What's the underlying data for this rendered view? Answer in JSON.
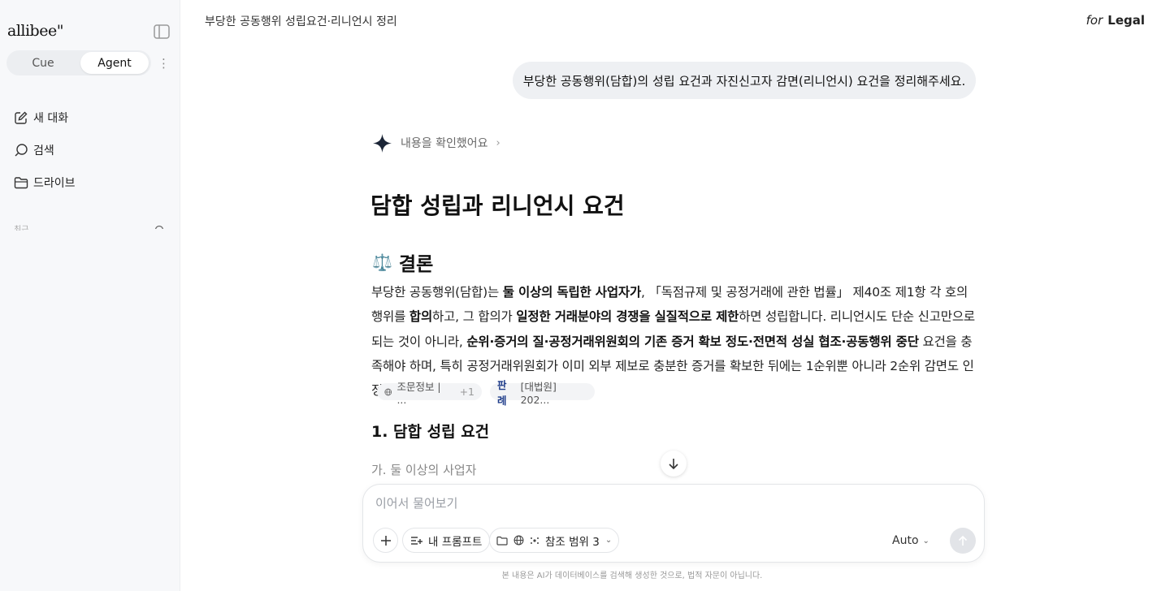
{
  "sidebar": {
    "logo": "allibee\"",
    "tabs": {
      "cue": "Cue",
      "agent": "Agent"
    },
    "nav": [
      {
        "label": "새 대화",
        "icon": "edit-icon"
      },
      {
        "label": "검색",
        "icon": "search-icon"
      },
      {
        "label": "드라이브",
        "icon": "folder-icon"
      }
    ],
    "recent_label": "최근"
  },
  "header": {
    "title": "부당한 공동행위 성립요건·리니언시 정리",
    "brand_for": "for",
    "brand_name": "Legal"
  },
  "conversation": {
    "user_message": "부당한 공동행위(담합)의 성립 요건과 자진신고자 감면(리니언시) 요건을 정리해주세요.",
    "status": "내용을 확인했어요",
    "answer_title": "담합 성립과 리니언시 요건",
    "section_conclusion": {
      "emoji": "⚖️",
      "label": "결론"
    },
    "paragraph": {
      "t1": "부당한 공동행위(담합)는 ",
      "b1": "둘 이상의 독립한 사업자가",
      "t2": ", 「독점규제 및 공정거래에 관한 법률」 제40조 제1항 각 호의 행위를 ",
      "b2": "합의",
      "t3": "하고, 그 합의가 ",
      "b3": "일정한 거래분야의 경쟁을 실질적으로 제한",
      "t4": "하면 성립합니다. 리니언시도 단순 신고만으로 되는 것이 아니라, ",
      "b4": "순위·증거의 질·공정거래위원회의 기존 증거 확보 정도·전면적 성실 협조·공동행위 중단",
      "t5": " 요건을 충족해야 하며, 특히 공정거래위원회가 이미 외부 제보로 충분한 증거를 확보한 뒤에는 1순위뿐 아니라 2순위 감면도 인정되지 않습니다."
    },
    "sources": [
      {
        "label": "조문정보 | ...",
        "extra": "+1"
      },
      {
        "tag": "판례",
        "label": "[대법원] 202..."
      }
    ],
    "section1": "1. 담합 성립 요건",
    "section1_sub": "가. 둘 이상의 사업자"
  },
  "composer": {
    "placeholder": "이어서 물어보기",
    "my_prompt": "내 프롬프트",
    "scope": "참조 범위 3",
    "mode": "Auto"
  },
  "disclaimer": "본 내용은 AI가 데이터베이스를 검색해 생성한 것으로, 법적 자문이 아닙니다."
}
